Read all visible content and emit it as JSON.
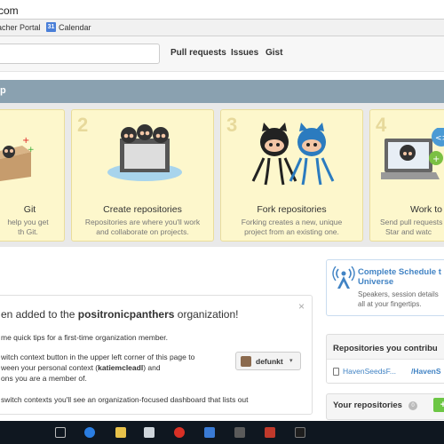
{
  "browser": {
    "url_fragment": "com",
    "bookmarks": [
      {
        "label": "acher Portal",
        "icon": "bookmark-icon"
      },
      {
        "label": "Calendar",
        "icon": "calendar-icon"
      }
    ],
    "calendar_icon_text": "31"
  },
  "header": {
    "search_placeholder": "",
    "nav": [
      "Pull requests",
      "Issues",
      "Gist"
    ]
  },
  "bootcamp": {
    "title": "p",
    "cards": [
      {
        "number": "",
        "title": "Git",
        "desc_line1": "help you get",
        "desc_line2": "th Git."
      },
      {
        "number": "2",
        "title": "Create repositories",
        "desc_line1": "Repositories are where you'll work",
        "desc_line2": "and collaborate on projects."
      },
      {
        "number": "3",
        "title": "Fork repositories",
        "desc_line1": "Forking creates a new, unique",
        "desc_line2": "project from an existing one."
      },
      {
        "number": "4",
        "title": "Work to",
        "desc_line1": "Send pull requests",
        "desc_line2": "Star and watc"
      }
    ],
    "colors": {
      "banner": "#8aa1b0",
      "card_bg": "#fdf7cc"
    }
  },
  "org_notice": {
    "heading_prefix": "en added to the ",
    "org_name": "positronicpanthers",
    "heading_suffix": " organization!",
    "close": "×",
    "line1": "me quick tips for a first-time organization member.",
    "line2": "witch context button in the upper left corner of this page to",
    "line3_prefix": "ween your personal context (",
    "username": "katiemcleadl",
    "line3_suffix": ") and",
    "line4": "ons you are a member of.",
    "line5": "switch contexts you'll see an organization-focused dashboard that lists out",
    "switcher_label": "defunkt",
    "switcher_caret": "▾"
  },
  "sidebar": {
    "universe": {
      "title_line1": "Complete Schedule t",
      "title_line2": "Universe",
      "desc_line1": "Speakers, session details",
      "desc_line2": "all at your fingertips."
    },
    "contributions": {
      "title": "Repositories you contribu",
      "repo_owner": "HavenSeedsF...",
      "repo_name": "/HavenS"
    },
    "your_repos": {
      "title": "Your repositories",
      "count": "0",
      "new_button": "+"
    }
  }
}
